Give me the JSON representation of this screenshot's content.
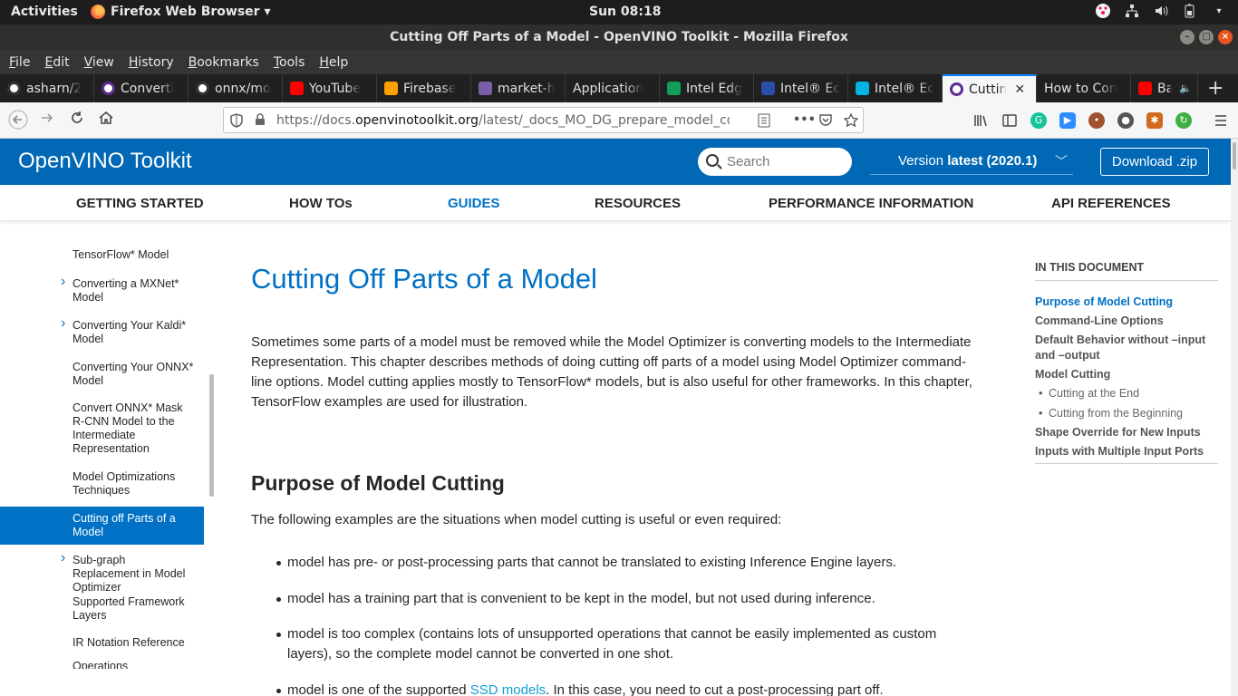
{
  "system": {
    "activities": "Activities",
    "app_menu": "Firefox Web Browser ▾",
    "clock": "Sun 08:18"
  },
  "window": {
    "title": "Cutting Off Parts of a Model - OpenVINO Toolkit - Mozilla Firefox"
  },
  "menubar": {
    "items": [
      {
        "label": "File",
        "accel": "F",
        "rest": "ile"
      },
      {
        "label": "Edit",
        "accel": "E",
        "rest": "dit"
      },
      {
        "label": "View",
        "accel": "V",
        "rest": "iew"
      },
      {
        "label": "History",
        "accel": "H",
        "rest": "istory"
      },
      {
        "label": "Bookmarks",
        "accel": "B",
        "rest": "ookmarks"
      },
      {
        "label": "Tools",
        "accel": "T",
        "rest": "ools"
      },
      {
        "label": "Help",
        "accel": "H",
        "rest": "elp"
      }
    ]
  },
  "tabs": [
    {
      "label": "asharn/2",
      "icon": "github-icon",
      "color": "#333333"
    },
    {
      "label": "Converti",
      "icon": "openvino-icon",
      "color": "#5c2d91"
    },
    {
      "label": "onnx/mo",
      "icon": "github-icon",
      "color": "#333333"
    },
    {
      "label": "YouTube",
      "icon": "youtube-icon",
      "color": "#ff0000"
    },
    {
      "label": "Firebase",
      "icon": "firebase-icon",
      "color": "#ffa000"
    },
    {
      "label": "market-h",
      "icon": "heroku-icon",
      "color": "#7b5ea7"
    },
    {
      "label": "Application",
      "icon": "",
      "color": ""
    },
    {
      "label": "Intel Edg",
      "icon": "plus-square-icon",
      "color": "#0f9d58"
    },
    {
      "label": "Intel® Ec",
      "icon": "intel-doc-icon",
      "color": "#2b4fa8"
    },
    {
      "label": "Intel® Ec",
      "icon": "udacity-icon",
      "color": "#02b3e4"
    },
    {
      "label": "Cuttin",
      "icon": "openvino-icon",
      "color": "#5c2d91",
      "active": true
    },
    {
      "label": "How to Con",
      "icon": "",
      "color": ""
    },
    {
      "label": "Basic",
      "icon": "youtube-icon",
      "color": "#ff0000"
    }
  ],
  "navbar": {
    "url_prefix": "https://docs.",
    "url_domain": "openvinotoolkit.org",
    "url_rest": "/latest/_docs_MO_DG_prepare_model_co"
  },
  "site": {
    "brand": "OpenVINO Toolkit",
    "search_placeholder": "Search",
    "version_prefix": "Version ",
    "version_value": "latest (2020.1)",
    "download_label": "Download .zip",
    "brand_color": "#0068b5",
    "accent_color": "#0071c5"
  },
  "mainnav": [
    {
      "label": "GETTING STARTED"
    },
    {
      "label": "HOW TOs"
    },
    {
      "label": "GUIDES",
      "active": true
    },
    {
      "label": "RESOURCES"
    },
    {
      "label": "PERFORMANCE INFORMATION"
    },
    {
      "label": "API REFERENCES"
    }
  ],
  "sidebar": {
    "items": [
      {
        "label": "TensorFlow* Model",
        "arrow": false
      },
      {
        "label": "Converting a MXNet* Model",
        "arrow": true
      },
      {
        "label": "Converting Your Kaldi* Model",
        "arrow": true
      },
      {
        "label": "Converting Your ONNX* Model",
        "arrow": false
      },
      {
        "label": "Convert ONNX* Mask R-CNN Model to the Intermediate Representation",
        "arrow": false
      },
      {
        "label": "Model Optimizations Techniques",
        "arrow": false
      },
      {
        "label": "Cutting off Parts of a Model",
        "arrow": false,
        "active": true
      },
      {
        "label": "Sub-graph Replacement in Model Optimizer",
        "arrow": true
      },
      {
        "label": "Supported Framework Layers",
        "arrow": false
      },
      {
        "label": "IR Notation Reference",
        "arrow": false
      },
      {
        "label": "Operations Specification",
        "arrow": false
      }
    ]
  },
  "content": {
    "title": "Cutting Off Parts of a Model",
    "intro": "Sometimes some parts of a model must be removed while the Model Optimizer is converting models to the Intermediate Representation. This chapter describes methods of doing cutting off parts of a model using Model Optimizer command-line options. Model cutting applies mostly to TensorFlow* models, but is also useful for other frameworks. In this chapter, TensorFlow examples are used for illustration.",
    "section_heading": "Purpose of Model Cutting",
    "section_lead": "The following examples are the situations when model cutting is useful or even required:",
    "bullets": [
      {
        "text": "model has pre- or post-processing parts that cannot be translated to existing Inference Engine layers."
      },
      {
        "text": "model has a training part that is convenient to be kept in the model, but not used during inference."
      },
      {
        "text": "model is too complex (contains lots of unsupported operations that cannot be easily implemented as custom layers), so the complete model cannot be converted in one shot."
      },
      {
        "prefix": "model is one of the supported ",
        "link": "SSD models",
        "suffix": ". In this case, you need to cut a post-processing part off."
      }
    ]
  },
  "toc": {
    "title": "IN THIS DOCUMENT",
    "items": [
      {
        "label": "Purpose of Model Cutting",
        "active": true
      },
      {
        "label": "Command-Line Options"
      },
      {
        "label": "Default Behavior without –input and –output"
      },
      {
        "label": "Model Cutting"
      },
      {
        "label": "Cutting at the End",
        "sub": true
      },
      {
        "label": "Cutting from the Beginning",
        "sub": true
      },
      {
        "label": "Shape Override for New Inputs"
      },
      {
        "label": "Inputs with Multiple Input Ports"
      }
    ]
  }
}
